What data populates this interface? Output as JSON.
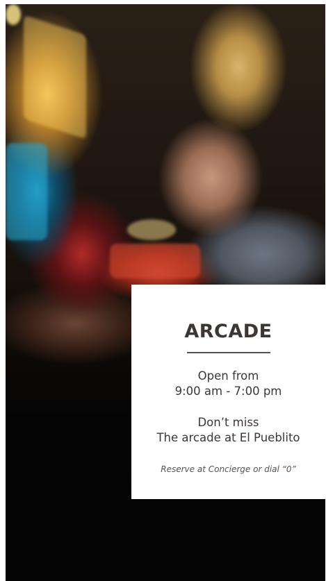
{
  "card": {
    "title": "ARCADE",
    "hours_label": "Open from",
    "hours_value": "9:00 am - 7:00 pm",
    "promo_line1": "Don’t miss",
    "promo_line2": "The arcade at El Pueblito",
    "reserve_note": "Reserve at Concierge or dial “0”"
  },
  "photo": {
    "subject": "arcade-photo"
  }
}
